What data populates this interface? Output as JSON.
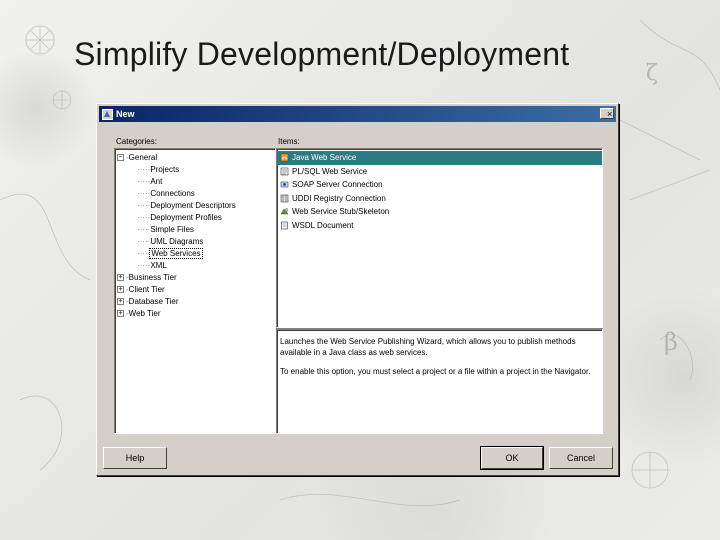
{
  "slide": {
    "title": "Simplify Development/Deployment"
  },
  "dialog": {
    "title": "New",
    "close_glyph": "×",
    "categories_label": "Categories:",
    "items_label": "Items:",
    "tree": [
      {
        "label": "General",
        "expander": "−",
        "children": [
          "Projects",
          "Ant",
          "Connections",
          "Deployment Descriptors",
          "Deployment Profiles",
          "Simple Files",
          "UML Diagrams",
          "Web Services",
          "XML"
        ]
      },
      {
        "label": "Business Tier",
        "expander": "+"
      },
      {
        "label": "Client Tier",
        "expander": "+"
      },
      {
        "label": "Database Tier",
        "expander": "+"
      },
      {
        "label": "Web Tier",
        "expander": "+"
      }
    ],
    "selected_category": "Web Services",
    "items": [
      {
        "label": "Java Web Service",
        "icon": "java-web-service-icon",
        "selected": true
      },
      {
        "label": "PL/SQL Web Service",
        "icon": "plsql-web-service-icon"
      },
      {
        "label": "SOAP Server Connection",
        "icon": "soap-connection-icon"
      },
      {
        "label": "UDDI Registry Connection",
        "icon": "uddi-registry-icon"
      },
      {
        "label": "Web Service Stub/Skeleton",
        "icon": "stub-skeleton-icon"
      },
      {
        "label": "WSDL Document",
        "icon": "wsdl-document-icon"
      }
    ],
    "description": [
      "Launches the Web Service Publishing Wizard, which allows you to publish methods available in a Java class as web services.",
      "To enable this option, you must select a project or a file within a project in the Navigator."
    ],
    "buttons": {
      "help": "Help",
      "ok": "OK",
      "cancel": "Cancel"
    }
  },
  "colors": {
    "titlebar": "#0a246a",
    "selection": "#2b7b83",
    "dialog_face": "#d4d0c8"
  }
}
